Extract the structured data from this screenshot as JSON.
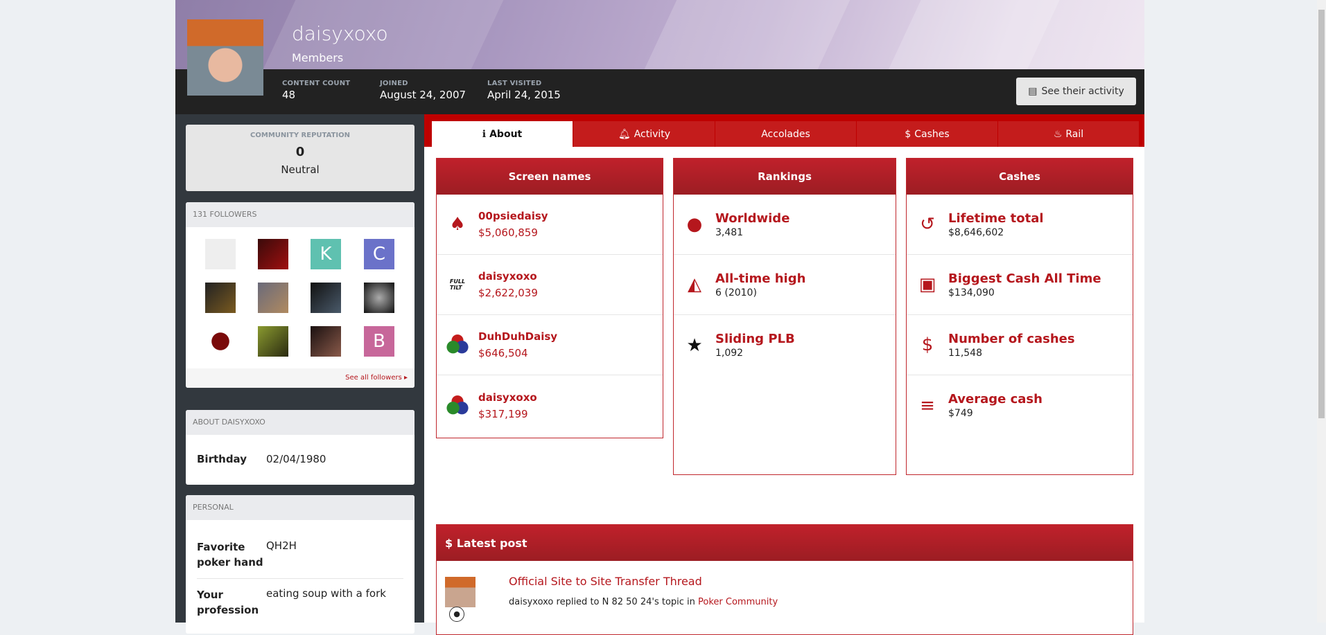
{
  "profile": {
    "name": "daisyxoxo",
    "group": "Members",
    "stats": [
      {
        "label": "CONTENT COUNT",
        "value": "48"
      },
      {
        "label": "JOINED",
        "value": "August 24, 2007"
      },
      {
        "label": "LAST VISITED",
        "value": "April 24, 2015"
      }
    ],
    "activity_button": "See their activity"
  },
  "reputation": {
    "label": "COMMUNITY REPUTATION",
    "value": "0",
    "level": "Neutral"
  },
  "followers": {
    "title": "131 FOLLOWERS",
    "see_all": "See all followers ▸",
    "letters": [
      "K",
      "C",
      "B"
    ]
  },
  "about": {
    "title": "ABOUT DAISYXOXO",
    "fields": [
      {
        "label": "Birthday",
        "value": "02/04/1980"
      }
    ]
  },
  "personal": {
    "title": "PERSONAL",
    "fields": [
      {
        "label": "Favorite poker hand",
        "value": "QH2H"
      },
      {
        "label": "Your profession",
        "value": "eating soup with a fork"
      }
    ]
  },
  "tabs": [
    {
      "label": "About",
      "icon": "info-icon",
      "glyph": "ℹ"
    },
    {
      "label": "Activity",
      "icon": "bell-icon",
      "glyph": "🔔︎"
    },
    {
      "label": "Accolades",
      "glyph": ""
    },
    {
      "label": "Cashes",
      "icon": "dollar-icon",
      "glyph": "$"
    },
    {
      "label": "Rail",
      "icon": "cake-icon",
      "glyph": "♨"
    }
  ],
  "screen_names": {
    "title": "Screen names",
    "items": [
      {
        "name": "00psiedaisy",
        "amount": "$5,060,859"
      },
      {
        "name": "daisyxoxo",
        "amount": "$2,622,039"
      },
      {
        "name": "DuhDuhDaisy",
        "amount": "$646,504"
      },
      {
        "name": "daisyxoxo",
        "amount": "$317,199"
      }
    ],
    "logo_text": "FULL TILT"
  },
  "rankings": {
    "title": "Rankings",
    "items": [
      {
        "label": "Worldwide",
        "value": "3,481"
      },
      {
        "label": "All-time high",
        "value": "6 (2010)"
      },
      {
        "label": "Sliding PLB",
        "value": "1,092"
      }
    ]
  },
  "cashes": {
    "title": "Cashes",
    "items": [
      {
        "label": "Lifetime total",
        "value": "$8,646,602"
      },
      {
        "label": "Biggest Cash All Time",
        "value": "$134,090"
      },
      {
        "label": "Number of cashes",
        "value": "11,548"
      },
      {
        "label": "Average cash",
        "value": "$749"
      }
    ]
  },
  "latest_post": {
    "title": "$ Latest post",
    "post_title": "Official Site to Site Transfer Thread",
    "meta_prefix": "daisyxoxo replied to N 82 50 24's topic in ",
    "forum": "Poker Community"
  },
  "colors": {
    "accent": "#be0000",
    "panel": "#c0212b",
    "sidebar": "#32383e"
  }
}
